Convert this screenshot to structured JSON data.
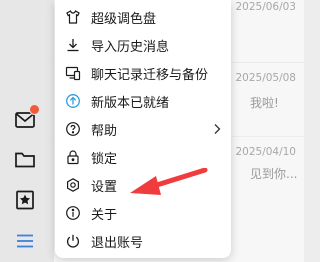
{
  "sidebar": {
    "icons": [
      {
        "name": "mail-icon",
        "has_badge": true
      },
      {
        "name": "folder-icon"
      },
      {
        "name": "bookmark-star-icon"
      },
      {
        "name": "hamburger-menu-icon",
        "color": "#3a82e0"
      }
    ]
  },
  "chat_list": {
    "rows": [
      {
        "date": "2025/06/03",
        "preview": ""
      },
      {
        "date": "2025/05/08",
        "preview": "我啦!"
      },
      {
        "date": "2025/04/10",
        "preview": "见到你..."
      }
    ]
  },
  "menu": {
    "items": [
      {
        "icon": "tshirt-icon",
        "label": "超级调色盘"
      },
      {
        "icon": "download-icon",
        "label": "导入历史消息"
      },
      {
        "icon": "device-transfer-icon",
        "label": "聊天记录迁移与备份"
      },
      {
        "icon": "update-arrow-icon",
        "label": "新版本已就绪",
        "icon_color": "#2f9de0"
      },
      {
        "icon": "help-circle-icon",
        "label": "帮助",
        "has_submenu": true
      },
      {
        "icon": "lock-icon",
        "label": "锁定"
      },
      {
        "icon": "settings-hexagon-icon",
        "label": "设置"
      },
      {
        "icon": "info-icon",
        "label": "关于"
      },
      {
        "icon": "power-icon",
        "label": "退出账号"
      }
    ]
  },
  "annotation": {
    "arrow_color": "#f03c3c",
    "points_to": "设置"
  }
}
